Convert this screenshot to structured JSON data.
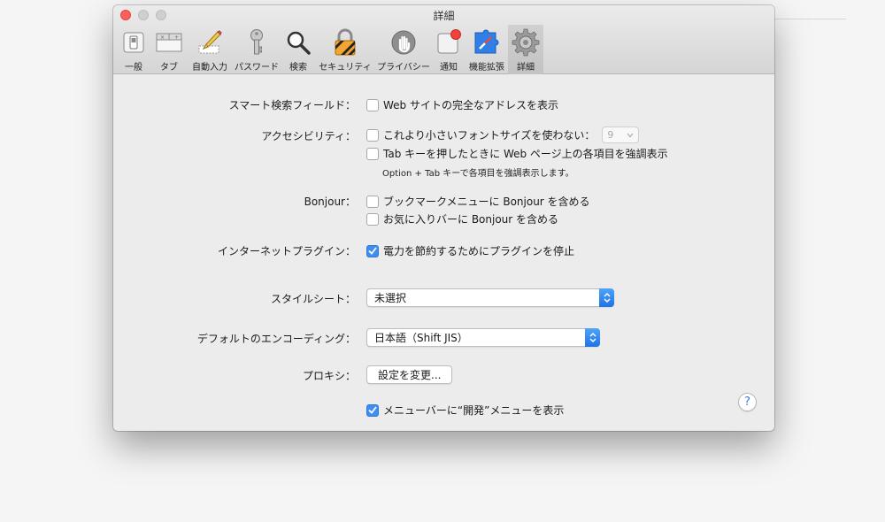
{
  "window": {
    "title": "詳細"
  },
  "toolbar": {
    "items": [
      {
        "label": "一般",
        "icon": "general-switch-icon"
      },
      {
        "label": "タブ",
        "icon": "tabs-icon"
      },
      {
        "label": "自動入力",
        "icon": "pencil-icon"
      },
      {
        "label": "パスワード",
        "icon": "key-icon"
      },
      {
        "label": "検索",
        "icon": "magnifier-icon"
      },
      {
        "label": "セキュリティ",
        "icon": "padlock-icon"
      },
      {
        "label": "プライバシー",
        "icon": "hand-icon"
      },
      {
        "label": "通知",
        "icon": "notification-icon"
      },
      {
        "label": "機能拡張",
        "icon": "puzzle-compass-icon"
      },
      {
        "label": "詳細",
        "icon": "gear-icon"
      }
    ],
    "selected": "詳細"
  },
  "settings": {
    "smart_search": {
      "label": "スマート検索フィールド：",
      "option": "Web サイトの完全なアドレスを表示",
      "checked": false
    },
    "accessibility": {
      "label": "アクセシビリティ：",
      "option1": "これより小さいフォントサイズを使わない：",
      "option1_checked": false,
      "font_size": "9",
      "option2": "Tab キーを押したときに Web ページ上の各項目を強調表示",
      "option2_checked": false,
      "hint": "Option + Tab キーで各項目を強調表示します。"
    },
    "bonjour": {
      "label": "Bonjour：",
      "option1": "ブックマークメニューに Bonjour を含める",
      "option1_checked": false,
      "option2": "お気に入りバーに Bonjour を含める",
      "option2_checked": false
    },
    "plugins": {
      "label": "インターネットプラグイン：",
      "option": "電力を節約するためにプラグインを停止",
      "checked": true
    },
    "stylesheet": {
      "label": "スタイルシート：",
      "value": "未選択"
    },
    "encoding": {
      "label": "デフォルトのエンコーディング：",
      "value": "日本語（Shift JIS）"
    },
    "proxy": {
      "label": "プロキシ：",
      "button": "設定を変更..."
    },
    "develop_menu": {
      "option": "メニューバーに“開発”メニューを表示",
      "checked": true
    },
    "help": "?"
  },
  "colors": {
    "accent": "#3d8ef0",
    "close": "#fc605c"
  }
}
